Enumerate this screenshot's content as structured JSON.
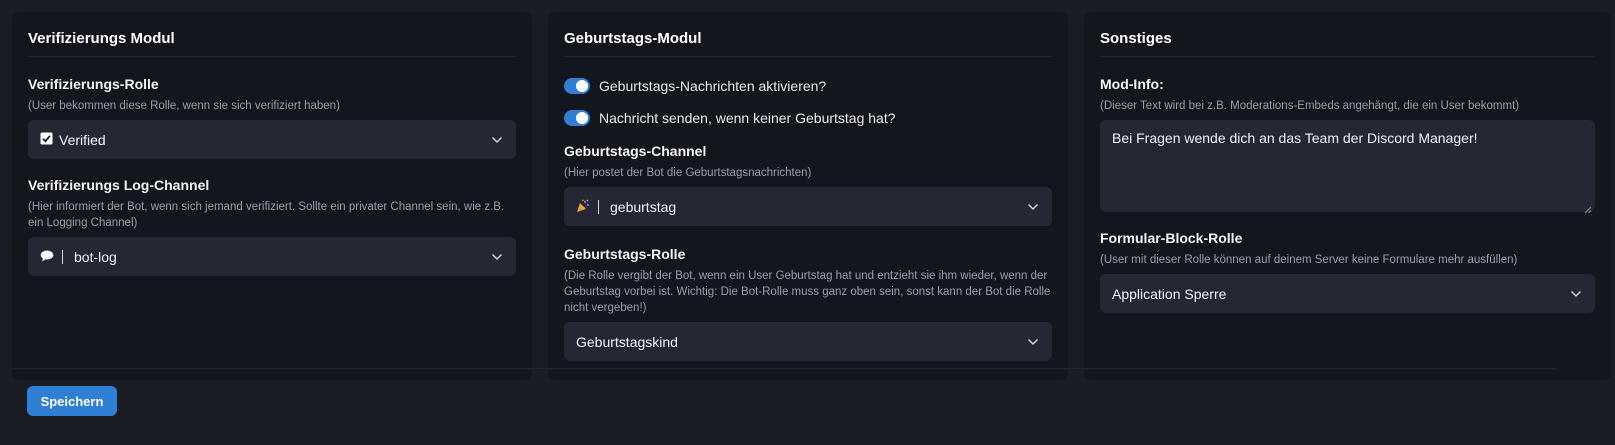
{
  "verification": {
    "title": "Verifizierungs Modul",
    "role": {
      "label": "Verifizierungs-Rolle",
      "help": "(User bekommen diese Rolle, wenn sie sich verifiziert haben)",
      "value": "Verified",
      "icon": "checkbox-icon"
    },
    "log_channel": {
      "label": "Verifizierungs Log-Channel",
      "help": "(Hier informiert der Bot, wenn sich jemand verifiziert. Sollte ein privater Channel sein, wie z.B. ein Logging Channel)",
      "value": "bot-log",
      "icon": "speech-bubble-icon"
    }
  },
  "birthday": {
    "title": "Geburtstags-Modul",
    "toggles": [
      {
        "label": "Geburtstags-Nachrichten aktivieren?",
        "on": true
      },
      {
        "label": "Nachricht senden, wenn keiner Geburtstag hat?",
        "on": true
      }
    ],
    "channel": {
      "label": "Geburtstags-Channel",
      "help": "(Hier postet der Bot die Geburtstagsnachrichten)",
      "value": "geburtstag",
      "icon": "party-popper-icon"
    },
    "role": {
      "label": "Geburtstags-Rolle",
      "help": "(Die Rolle vergibt der Bot, wenn ein User Geburtstag hat und entzieht sie ihm wieder, wenn der Geburtstag vorbei ist. Wichtig: Die Bot-Rolle muss ganz oben sein, sonst kann der Bot die Rolle nicht vergeben!)",
      "value": "Geburtstagskind"
    }
  },
  "misc": {
    "title": "Sonstiges",
    "mod_info": {
      "label": "Mod-Info:",
      "help": "(Dieser Text wird bei z.B. Moderations-Embeds angehängt, die ein User bekommt)",
      "value": "Bei Fragen wende dich an das Team der Discord Manager!"
    },
    "form_block_role": {
      "label": "Formular-Block-Rolle",
      "help": "(User mit dieser Rolle können auf deinem Server keine Formulare mehr ausfüllen)",
      "value": "Application Sperre"
    }
  },
  "save_label": "Speichern",
  "colors": {
    "accent": "#2f7fd4",
    "background": "#1b1d26",
    "card": "#14161e",
    "input": "#252834"
  }
}
